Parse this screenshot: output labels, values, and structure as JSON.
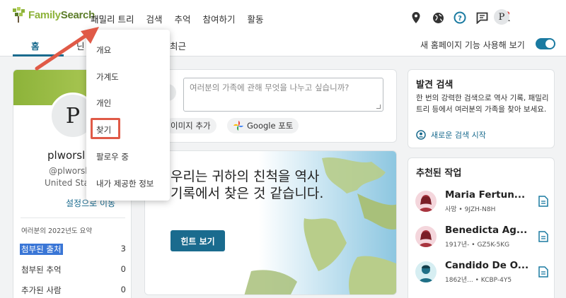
{
  "brand": {
    "logo_text_a": "Family",
    "logo_text_b": "Search"
  },
  "nav": {
    "links": [
      "패밀리 트리",
      "검색",
      "추억",
      "참여하기",
      "활동"
    ],
    "avatar_letter": "P",
    "icons": [
      "map-pin-icon",
      "globe-icon",
      "help-icon",
      "message-icon",
      "bell-icon"
    ]
  },
  "subnav": {
    "home": "홈",
    "recent": "최근",
    "partial_left": "닌",
    "toggle_label": "새 홈페이지 기능 사용해 보기"
  },
  "dropdown": {
    "items": [
      "개요",
      "가계도",
      "개인",
      "찾기",
      "팔로우 중",
      "내가 제공한 정보"
    ]
  },
  "profile": {
    "letter": "P",
    "name": "plworsl",
    "username": "@plworsl",
    "location": "United Sta",
    "settings_link": "설정으로 이동",
    "summary_title": "여러분의 2022년도 요약",
    "summary": [
      {
        "label": "첨부된 출처",
        "value": "3"
      },
      {
        "label": "첨부된 추억",
        "value": "0"
      },
      {
        "label": "추가된 사람",
        "value": "0"
      }
    ]
  },
  "post": {
    "placeholder": "여러분의 가족에 관해 무엇을 나누고 싶습니까?",
    "btn_image": "이미지 추가",
    "btn_google": "Google 포토"
  },
  "hint": {
    "text": "우리는 귀하의 친척을 역사 기록에서 찾은 것 같습니다.",
    "button": "힌트 보기"
  },
  "discover": {
    "title": "발견 검색",
    "description": "한 번의 강력한 검색으로 역사 기록, 패밀리 트리 등에서 여러분의 가족을 찾아 보세요.",
    "link": "새로운 검색 시작"
  },
  "tasks": {
    "title": "추천된 작업",
    "items": [
      {
        "name": "Maria Fertun...",
        "meta": "사망 • 9JZH-N8H",
        "gender": "female"
      },
      {
        "name": "Benedicta Ag...",
        "meta": "1917년- • GZ5K-5KG",
        "gender": "female"
      },
      {
        "name": "Candido De O...",
        "meta": "1862년... • KCBP-4Y5",
        "gender": "male"
      }
    ]
  },
  "colors": {
    "accent": "#1a6b8e",
    "brand": "#8db33a",
    "highlight": "#e05a47"
  }
}
